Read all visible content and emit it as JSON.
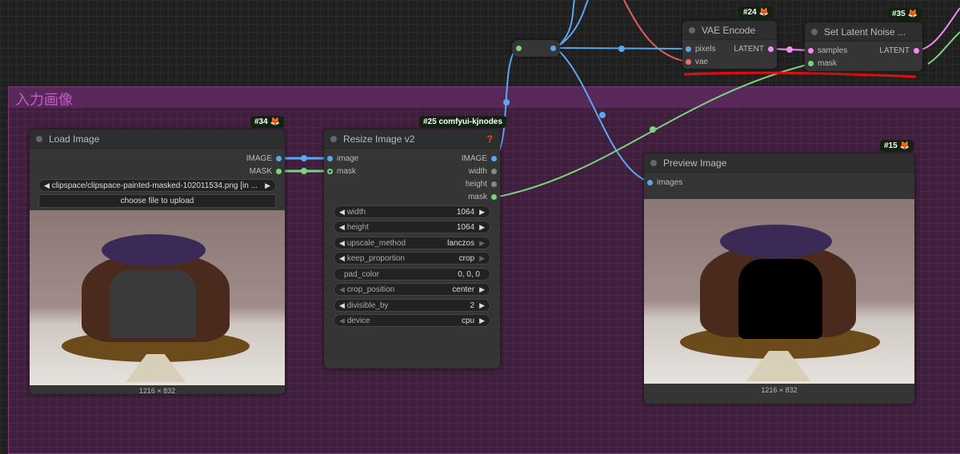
{
  "group": {
    "title": "入力画像"
  },
  "reroute": {},
  "vae_encode": {
    "badge": "#24",
    "title": "VAE Encode",
    "inputs": [
      "pixels",
      "vae"
    ],
    "outputs": [
      "LATENT"
    ]
  },
  "set_latent": {
    "badge": "#35",
    "title": "Set Latent Noise ...",
    "inputs": [
      "samples",
      "mask"
    ],
    "outputs": [
      "LATENT"
    ]
  },
  "load_image": {
    "badge": "#34",
    "title": "Load Image",
    "outputs": [
      "IMAGE",
      "MASK"
    ],
    "file": "clipspace/clipspace-painted-masked-102011534.png [in ...",
    "upload_label": "choose file to upload",
    "dims": "1216 × 832"
  },
  "resize": {
    "badge": "#25 comfyui-kjnodes",
    "title": "Resize Image v2",
    "help": "?",
    "inputs": [
      "image",
      "mask"
    ],
    "outputs": [
      "IMAGE",
      "width",
      "height",
      "mask"
    ],
    "widgets": [
      {
        "label": "width",
        "value": "1064"
      },
      {
        "label": "height",
        "value": "1064"
      },
      {
        "label": "upscale_method",
        "value": "lanczos"
      },
      {
        "label": "keep_proportion",
        "value": "crop"
      },
      {
        "label": "pad_color",
        "value": "0, 0, 0"
      },
      {
        "label": "crop_position",
        "value": "center"
      },
      {
        "label": "divisible_by",
        "value": "2"
      },
      {
        "label": "device",
        "value": "cpu"
      }
    ]
  },
  "preview": {
    "badge": "#15",
    "title": "Preview Image",
    "inputs": [
      "images"
    ],
    "dims": "1216 × 832"
  },
  "colors": {
    "image": "#5aa8f0",
    "mask": "#7dd37d",
    "latent": "#f08ef0",
    "vae": "#f06a6a",
    "annotation": "#e01010"
  }
}
